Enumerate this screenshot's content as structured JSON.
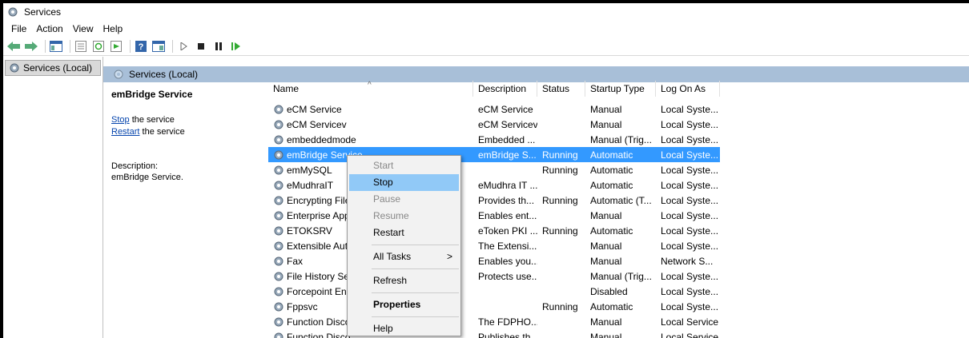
{
  "window": {
    "title": "Services"
  },
  "menu": [
    "File",
    "Action",
    "View",
    "Help"
  ],
  "tree": {
    "root_label": "Services (Local)"
  },
  "header": {
    "label": "Services (Local)"
  },
  "detail": {
    "title": "emBridge Service",
    "stop_link": "Stop",
    "stop_suffix": " the service",
    "restart_link": "Restart",
    "restart_suffix": " the service",
    "desc_label": "Description:",
    "desc_text": "emBridge Service."
  },
  "columns": {
    "name": "Name",
    "description": "Description",
    "status": "Status",
    "startup": "Startup Type",
    "logon": "Log On As"
  },
  "rows": [
    {
      "name": "eCM Service",
      "description": "eCM Service",
      "status": "",
      "startup": "Manual",
      "logon": "Local Syste..."
    },
    {
      "name": "eCM Servicev",
      "description": "eCM Servicev",
      "status": "",
      "startup": "Manual",
      "logon": "Local Syste..."
    },
    {
      "name": "embeddedmode",
      "description": "Embedded ...",
      "status": "",
      "startup": "Manual (Trig...",
      "logon": "Local Syste..."
    },
    {
      "name": "emBridge Service",
      "description": "emBridge S...",
      "status": "Running",
      "startup": "Automatic",
      "logon": "Local Syste..."
    },
    {
      "name": "emMySQL",
      "description": "",
      "status": "Running",
      "startup": "Automatic",
      "logon": "Local Syste..."
    },
    {
      "name": "eMudhraIT",
      "description": "eMudhra IT ...",
      "status": "",
      "startup": "Automatic",
      "logon": "Local Syste..."
    },
    {
      "name": "Encrypting File",
      "description": "Provides th...",
      "status": "Running",
      "startup": "Automatic (T...",
      "logon": "Local Syste..."
    },
    {
      "name": "Enterprise App",
      "description": "Enables ent...",
      "status": "",
      "startup": "Manual",
      "logon": "Local Syste..."
    },
    {
      "name": "ETOKSRV",
      "description": "eToken PKI ...",
      "status": "Running",
      "startup": "Automatic",
      "logon": "Local Syste..."
    },
    {
      "name": "Extensible Auth",
      "description": "The Extensi...",
      "status": "",
      "startup": "Manual",
      "logon": "Local Syste..."
    },
    {
      "name": "Fax",
      "description": "Enables you...",
      "status": "",
      "startup": "Manual",
      "logon": "Network S..."
    },
    {
      "name": "File History Ser",
      "description": "Protects use...",
      "status": "",
      "startup": "Manual (Trig...",
      "logon": "Local Syste..."
    },
    {
      "name": "Forcepoint Enc",
      "description": "",
      "status": "",
      "startup": "Disabled",
      "logon": "Local Syste..."
    },
    {
      "name": "Fppsvc",
      "description": "",
      "status": "Running",
      "startup": "Automatic",
      "logon": "Local Syste..."
    },
    {
      "name": "Function Disco",
      "description": "The FDPHO...",
      "status": "",
      "startup": "Manual",
      "logon": "Local Service"
    },
    {
      "name": "Function Disco",
      "description": "Publishes th...",
      "status": "",
      "startup": "Manual",
      "logon": "Local Service"
    }
  ],
  "context_menu": {
    "start": "Start",
    "stop": "Stop",
    "pause": "Pause",
    "resume": "Resume",
    "restart": "Restart",
    "all_tasks": "All Tasks",
    "all_tasks_arrow": ">",
    "refresh": "Refresh",
    "properties": "Properties",
    "help": "Help"
  },
  "colors": {
    "selection": "#3399ff",
    "header_band": "#a8bfd8",
    "menu_hover": "#91c9f7",
    "link": "#0645ad"
  },
  "icons": [
    "services-gear-icon",
    "back-arrow-icon",
    "forward-arrow-icon",
    "console-tree-icon",
    "properties-icon",
    "refresh-icon",
    "export-icon",
    "help-icon",
    "view-icon",
    "play-icon",
    "stop-icon",
    "pause-icon",
    "restart-icon"
  ]
}
